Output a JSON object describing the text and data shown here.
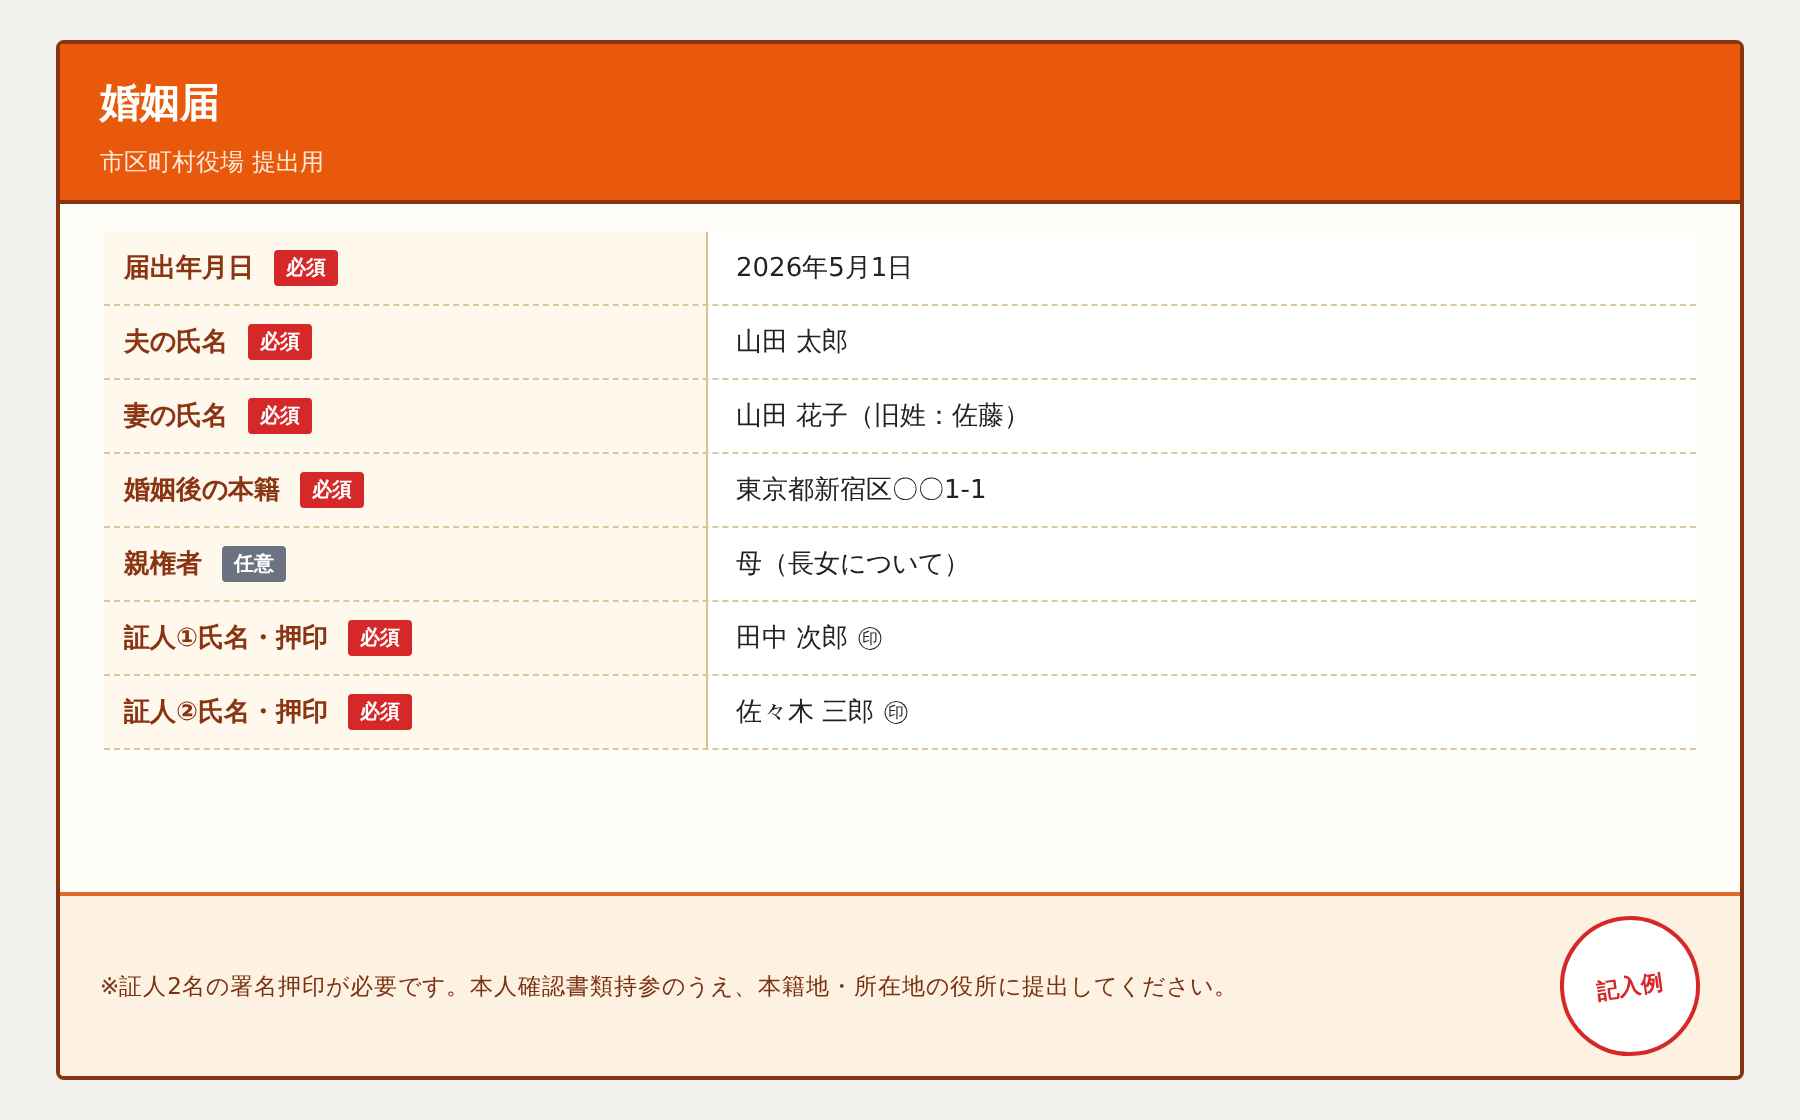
{
  "header": {
    "title": "婚姻届",
    "subtitle": "市区町村役場 提出用"
  },
  "rows": [
    {
      "label": "届出年月日",
      "badge": {
        "text": "必須",
        "required": true
      },
      "value": "2026年5月1日"
    },
    {
      "label": "夫の氏名",
      "badge": {
        "text": "必須",
        "required": true
      },
      "value": "山田 太郎"
    },
    {
      "label": "妻の氏名",
      "badge": {
        "text": "必須",
        "required": true
      },
      "value": "山田 花子（旧姓：佐藤）"
    },
    {
      "label": "婚姻後の本籍",
      "badge": {
        "text": "必須",
        "required": true
      },
      "value": "東京都新宿区〇〇1-1"
    },
    {
      "label": "親権者",
      "badge": {
        "text": "任意",
        "required": false
      },
      "value": "母（長女について）"
    },
    {
      "label": "証人①氏名・押印",
      "badge": {
        "text": "必須",
        "required": true
      },
      "value": "田中 次郎 ㊞"
    },
    {
      "label": "証人②氏名・押印",
      "badge": {
        "text": "必須",
        "required": true
      },
      "value": "佐々木 三郎 ㊞"
    }
  ],
  "footer": {
    "note": "※証人2名の署名押印が必要です。本人確認書類持参のうえ、本籍地・所在地の役所に提出してください。",
    "stamp": "記入例"
  }
}
